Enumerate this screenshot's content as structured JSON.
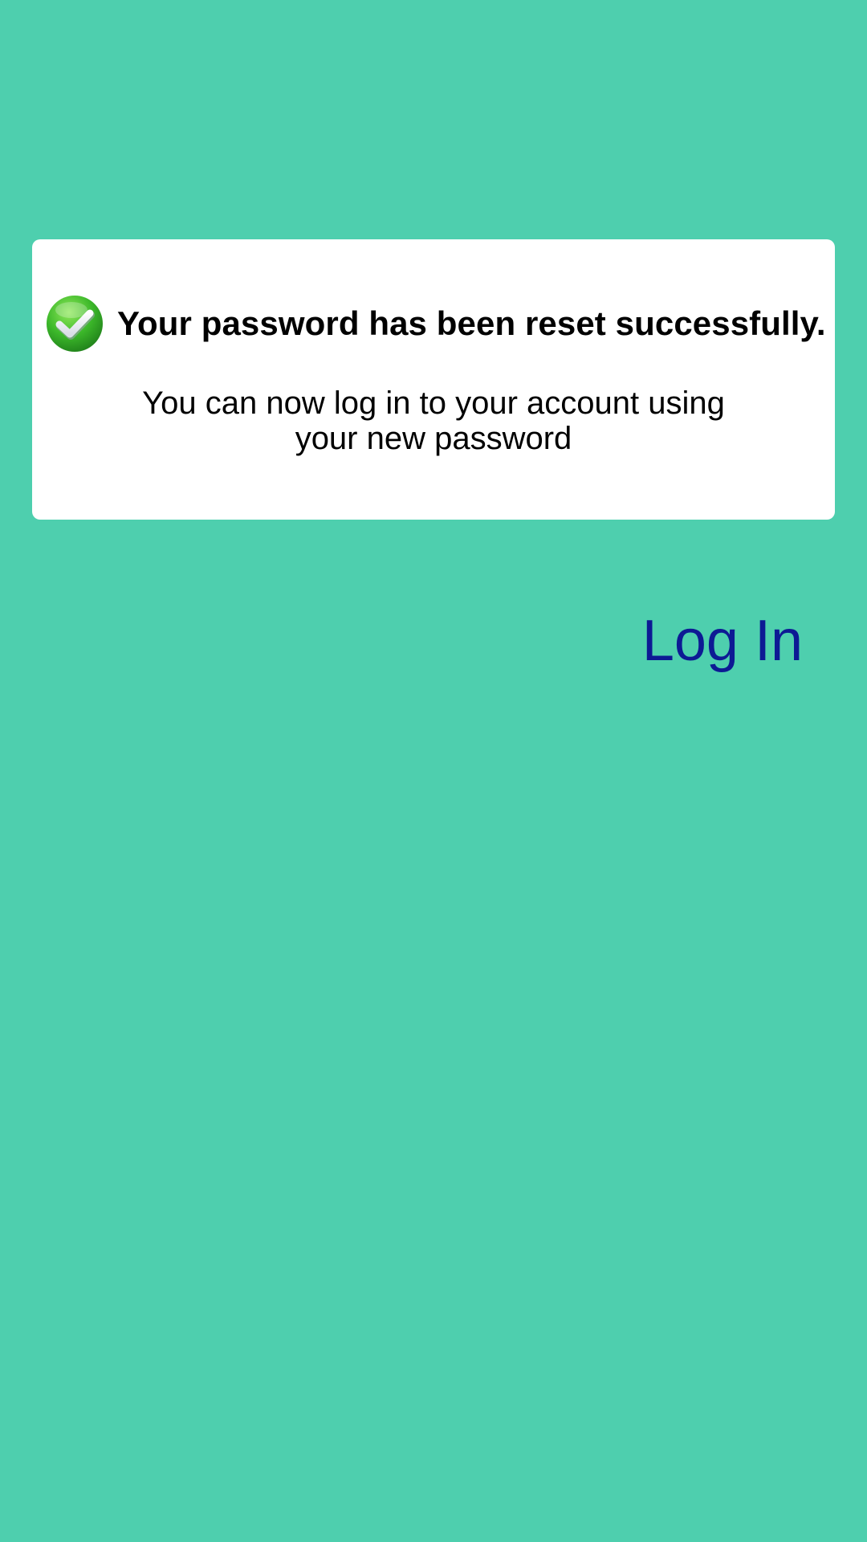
{
  "card": {
    "title": "Your password has been reset successfully.",
    "message_line1": "You can now log in to your account using",
    "message_line2": "your new password",
    "icon": "check-circle-icon"
  },
  "actions": {
    "login_label": "Log In"
  },
  "colors": {
    "background": "#4ecfae",
    "card": "#ffffff",
    "link": "#0d1a94",
    "success": "#3cb82a"
  }
}
